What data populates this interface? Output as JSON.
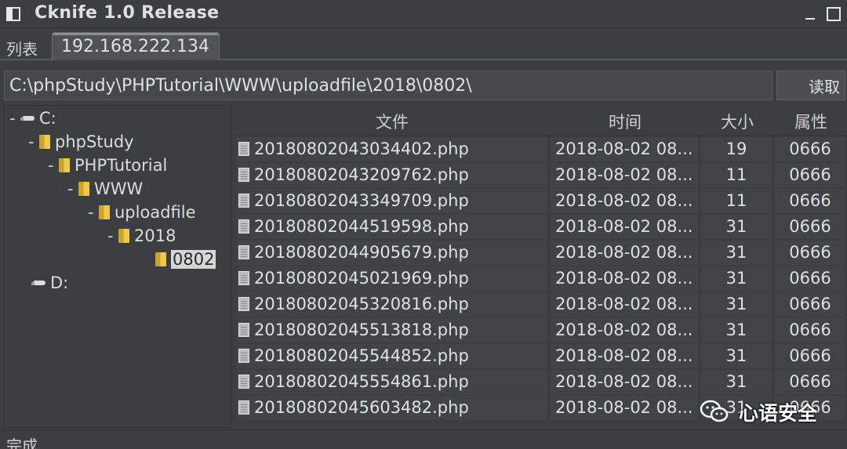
{
  "window": {
    "title": "Cknife 1.0 Release"
  },
  "tabs": [
    {
      "label": "列表"
    },
    {
      "label": "192.168.222.134"
    }
  ],
  "pathbar": {
    "path": "C:\\phpStudy\\PHPTutorial\\WWW\\uploadfile\\2018\\0802\\",
    "read_label": "读取"
  },
  "tree": [
    {
      "toggle": "-",
      "icon": "drive-icon",
      "label": "C:"
    },
    {
      "toggle": "-",
      "icon": "folder-icon",
      "label": "phpStudy"
    },
    {
      "toggle": "-",
      "icon": "folder-icon",
      "label": "PHPTutorial"
    },
    {
      "toggle": "-",
      "icon": "folder-icon",
      "label": "WWW"
    },
    {
      "toggle": "-",
      "icon": "folder-icon",
      "label": "uploadfile"
    },
    {
      "toggle": "-",
      "icon": "folder-icon",
      "label": "2018"
    },
    {
      "toggle": "",
      "icon": "folder-icon",
      "label": "0802",
      "selected": true
    },
    {
      "toggle": "",
      "icon": "drive-icon",
      "label": "D:"
    }
  ],
  "table": {
    "columns": [
      "文件",
      "时间",
      "大小",
      "属性"
    ],
    "rows": [
      {
        "name": "20180802043034402.php",
        "time": "2018-08-02 08...",
        "size": "19",
        "attr": "0666"
      },
      {
        "name": "20180802043209762.php",
        "time": "2018-08-02 08...",
        "size": "11",
        "attr": "0666"
      },
      {
        "name": "20180802043349709.php",
        "time": "2018-08-02 08...",
        "size": "11",
        "attr": "0666"
      },
      {
        "name": "20180802044519598.php",
        "time": "2018-08-02 08...",
        "size": "31",
        "attr": "0666"
      },
      {
        "name": "20180802044905679.php",
        "time": "2018-08-02 08...",
        "size": "31",
        "attr": "0666"
      },
      {
        "name": "20180802045021969.php",
        "time": "2018-08-02 08...",
        "size": "31",
        "attr": "0666"
      },
      {
        "name": "20180802045320816.php",
        "time": "2018-08-02 08...",
        "size": "31",
        "attr": "0666"
      },
      {
        "name": "20180802045513818.php",
        "time": "2018-08-02 08...",
        "size": "31",
        "attr": "0666"
      },
      {
        "name": "20180802045544852.php",
        "time": "2018-08-02 08...",
        "size": "31",
        "attr": "0666"
      },
      {
        "name": "20180802045554861.php",
        "time": "2018-08-02 08...",
        "size": "31",
        "attr": "0666"
      },
      {
        "name": "20180802045603482.php",
        "time": "2018-08-02 08...",
        "size": "31",
        "attr": "0666"
      }
    ]
  },
  "status": {
    "text": "完成"
  },
  "watermark": {
    "text": "心语安全"
  }
}
